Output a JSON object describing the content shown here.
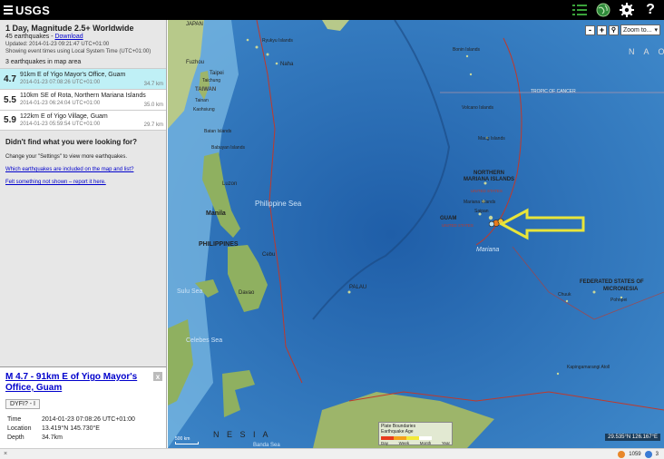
{
  "header": {
    "logo_text": "USGS",
    "icons": [
      "list-icon",
      "globe-icon",
      "gear-icon",
      "help-icon"
    ]
  },
  "sidebar": {
    "title": "1 Day, Magnitude 2.5+ Worldwide",
    "count_text": "45 earthquakes - ",
    "download_label": "Download",
    "updated": "Updated: 2014-01-23 09:21:47 UTC+01:00",
    "timezone_note": "Showing event times using Local System Time (UTC+01:00)",
    "in_map_area": "3 earthquakes in map area",
    "earthquakes": [
      {
        "mag": "4.7",
        "place": "91km E of Yigo Mayor's Office, Guam",
        "time": "2014-01-23 07:08:26 UTC+01:00",
        "depth": "34.7 km"
      },
      {
        "mag": "5.5",
        "place": "110km SE of Rota, Northern Mariana Islands",
        "time": "2014-01-23 06:24:04 UTC+01:00",
        "depth": "35.0 km"
      },
      {
        "mag": "5.9",
        "place": "122km E of Yigo Village, Guam",
        "time": "2014-01-23 05:59:54 UTC+01:00",
        "depth": "29.7 km"
      }
    ],
    "not_found_heading": "Didn't find what you were looking for?",
    "settings_hint": "Change your \"Settings\" to view more earthquakes.",
    "link_included": "Which earthquakes are included on the map and list?",
    "link_report": "Felt something not shown – report it here."
  },
  "detail": {
    "title": "M 4.7 - 91km E of Yigo Mayor's Office, Guam",
    "dyfi": "DYFI? - I",
    "rows": [
      {
        "label": "Time",
        "value": "2014-01-23 07:08:26 UTC+01:00"
      },
      {
        "label": "Location",
        "value": "13.419°N 145.730°E"
      },
      {
        "label": "Depth",
        "value": "34.7km"
      }
    ]
  },
  "map": {
    "zoom_in": "+",
    "zoom_out": "-",
    "zoom_to_label": "Zoom to...",
    "coords": "29.535°N 126.167°E",
    "legend_title": "Earthquake Age",
    "legend_header": "Plate Boundaries",
    "legend_ages": [
      "Day",
      "Week",
      "Month",
      "Year"
    ],
    "legend_colors": [
      "#e83b1d",
      "#f5a21b",
      "#f2e93a",
      "#ffffff"
    ],
    "scale_label": "500 km",
    "labels": {
      "japan_partial": "JAPAN",
      "nao": "N A O",
      "ryukyu": "Ryukyu Islands",
      "naha": "Naha",
      "fuzhou": "Fuzhou",
      "taipei": "Taipei",
      "taiwan": "TAIWAN",
      "taichung": "Taichung",
      "tainan": "Tainan",
      "kaohsiung": "Kaohsiung",
      "bonin": "Bonin Islands",
      "volcano": "Volcano Islands",
      "tropic": "TROPIC OF CANCER",
      "batan": "Batan Islands",
      "babuyan": "Babuyan Islands",
      "luzon": "Luzon",
      "manila": "Manila",
      "philippine_sea": "Philippine Sea",
      "philippines": "PHILIPPINES",
      "cebu": "Cebu",
      "sulu": "Sulu Sea",
      "davao": "Davao",
      "celebes": "Celebes Sea",
      "palau": "PALAU",
      "nmi": "NORTHERN MARIANA ISLANDS",
      "nmi_sub": "UNITED STATES",
      "mariana_islands": "Mariana Islands",
      "saipan": "Saipan",
      "guam": "GUAM",
      "guam_sub": "UNITED STATES",
      "maug": "Maug Islands",
      "fsm": "FEDERATED STATES OF",
      "fsm2": "MICRONESIA",
      "chuuk": "Chuuk",
      "pohnpei": "Pohnpei",
      "kapinga": "Kapingamarangi Atoll",
      "nesia": "N E S I A",
      "banda": "Banda Sea",
      "mariana_trench": "Mariana"
    }
  },
  "footer": {
    "close_x": "×",
    "counter1": "1059",
    "counter2": "3"
  }
}
